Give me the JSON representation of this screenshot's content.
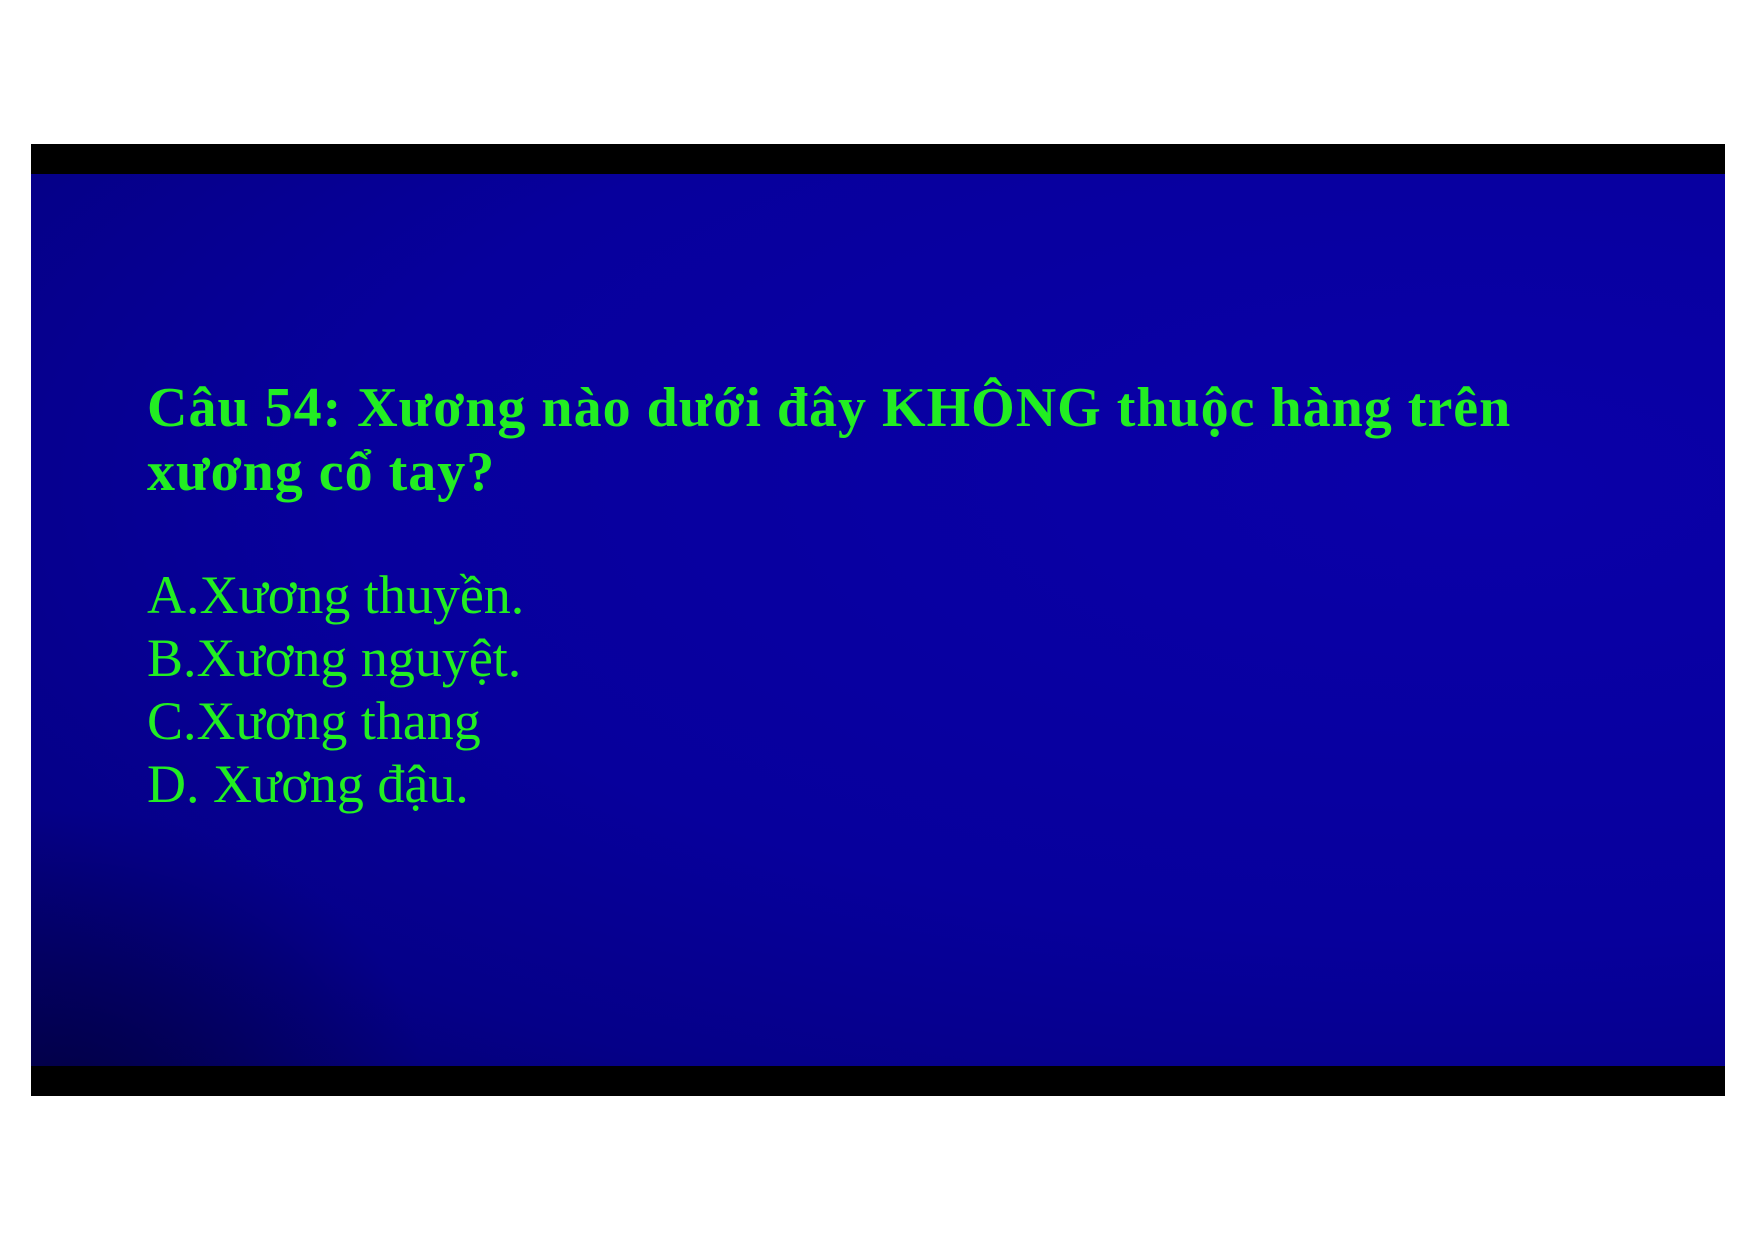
{
  "slide": {
    "question": "Câu 54: Xương nào dưới đây KHÔNG thuộc hàng trên xương cổ tay?",
    "answers": [
      "A.Xương thuyền.",
      "B.Xương nguyệt.",
      "C.Xương thang",
      "D. Xương đậu."
    ]
  },
  "colors": {
    "background": "#07009c",
    "text": "#22ee22",
    "frame": "#000000"
  }
}
